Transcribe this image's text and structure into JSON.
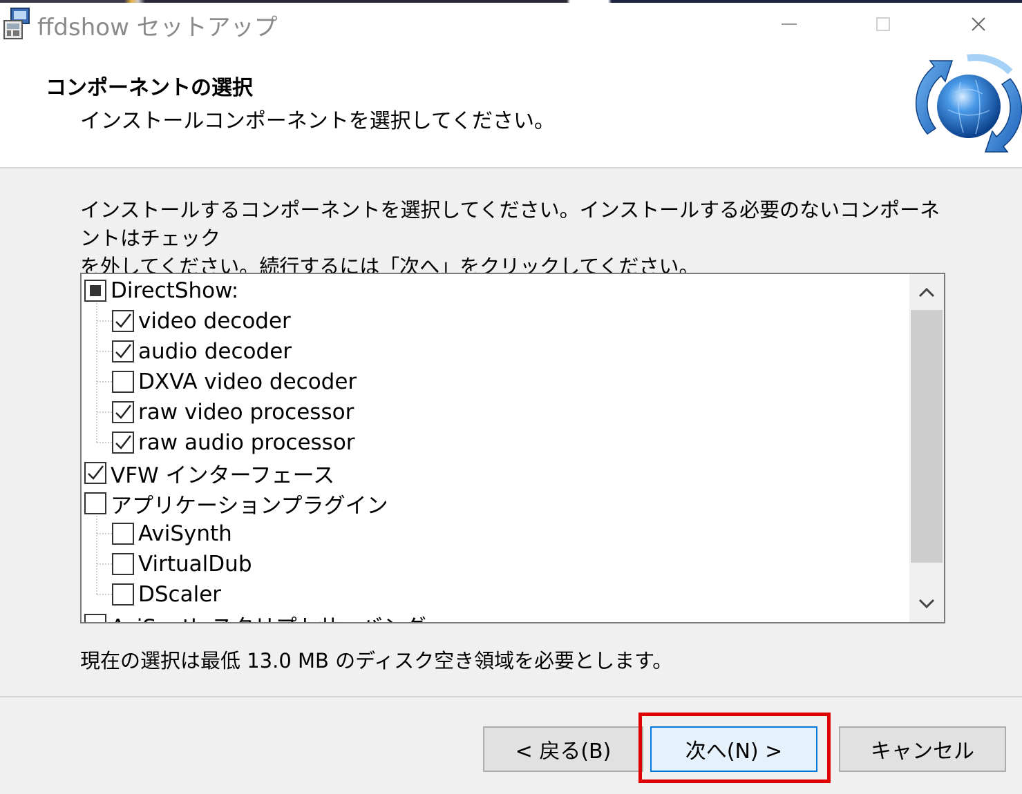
{
  "window": {
    "title": "ffdshow セットアップ",
    "minimize_label": "—",
    "close_label": "✕"
  },
  "header": {
    "title": "コンポーネントの選択",
    "subtitle": "インストールコンポーネントを選択してください。"
  },
  "description": {
    "line1": "インストールするコンポーネントを選択してください。インストールする必要のないコンポーネントはチェック",
    "line2": "を外してください。続行するには「次へ」をクリックしてください。"
  },
  "components": [
    {
      "label": "DirectShow:",
      "state": "partial",
      "level": 0
    },
    {
      "label": "video decoder",
      "state": "checked",
      "level": 1
    },
    {
      "label": "audio decoder",
      "state": "checked",
      "level": 1
    },
    {
      "label": "DXVA video decoder",
      "state": "unchecked",
      "level": 1
    },
    {
      "label": "raw video processor",
      "state": "checked",
      "level": 1
    },
    {
      "label": "raw audio processor",
      "state": "checked",
      "level": 1
    },
    {
      "label": "VFW インターフェース",
      "state": "checked",
      "level": 0
    },
    {
      "label": "アプリケーションプラグイン",
      "state": "unchecked",
      "level": 0
    },
    {
      "label": "AviSynth",
      "state": "unchecked",
      "level": 1
    },
    {
      "label": "VirtualDub",
      "state": "unchecked",
      "level": 1
    },
    {
      "label": "DScaler",
      "state": "unchecked",
      "level": 1
    },
    {
      "label": "AviSynth スクリプトサーバング",
      "state": "unchecked",
      "level": 0
    }
  ],
  "space_required": "現在の選択は最低 13.0 MB のディスク空き領域を必要とします。",
  "buttons": {
    "back": "< 戻る(B)",
    "next": "次へ(N) >",
    "cancel": "キャンセル"
  },
  "colors": {
    "highlight": "#e00000",
    "focus_border": "#0078d7"
  }
}
